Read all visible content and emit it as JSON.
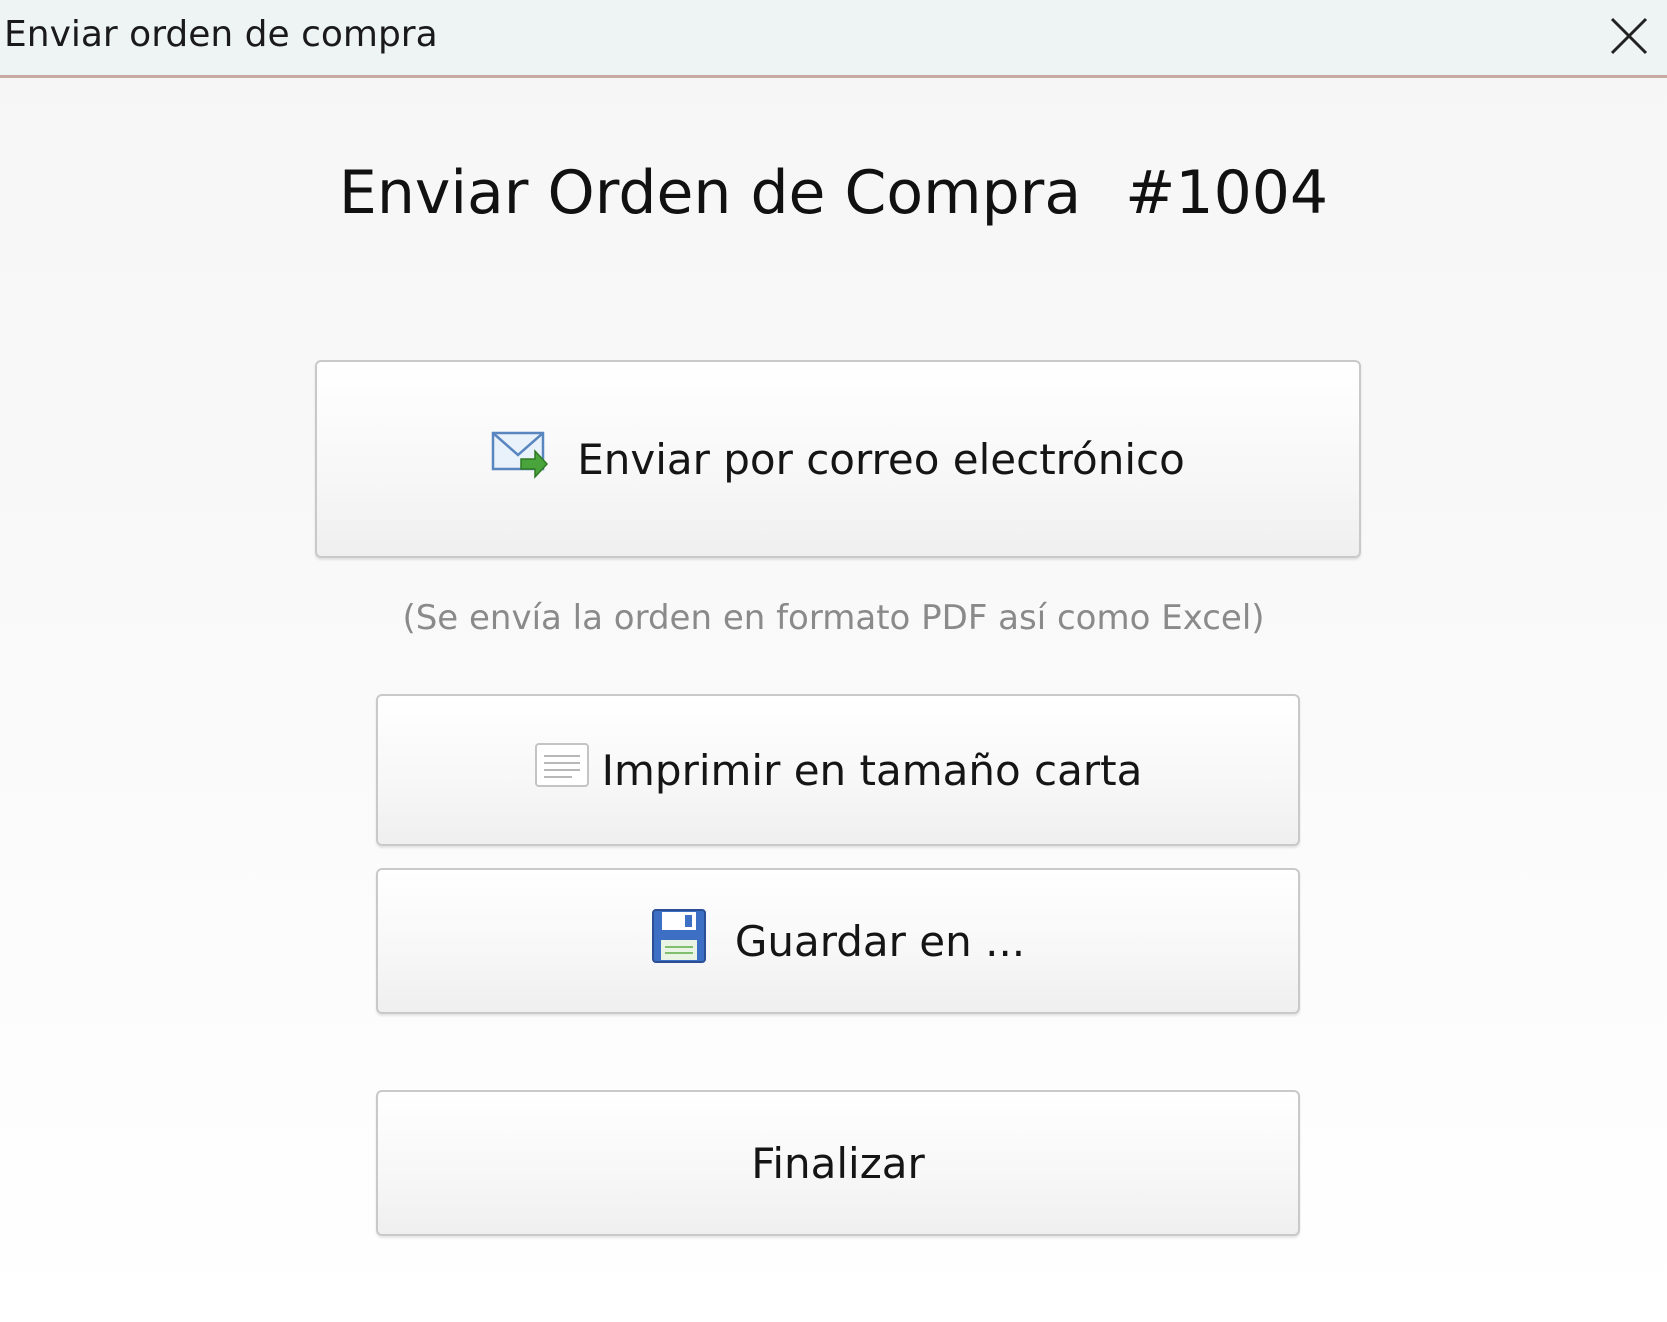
{
  "window": {
    "title": "Enviar orden de compra",
    "close_icon": "close-icon"
  },
  "main": {
    "heading_label": "Enviar Orden de Compra",
    "order_number": "#1004",
    "email_button": {
      "label": "Enviar por correo electrónico",
      "icon": "email-send-icon"
    },
    "email_hint": "(Se envía la orden en formato PDF así como Excel)",
    "print_button": {
      "label": "Imprimir en tamaño carta",
      "icon": "document-icon"
    },
    "save_button": {
      "label": "Guardar en ...",
      "icon": "floppy-disk-icon"
    },
    "finish_button": {
      "label": "Finalizar"
    }
  },
  "colors": {
    "titlebar_bg": "#eef4f4",
    "titlebar_border": "#c8aaa4",
    "hint_text": "#8a8a8a"
  }
}
